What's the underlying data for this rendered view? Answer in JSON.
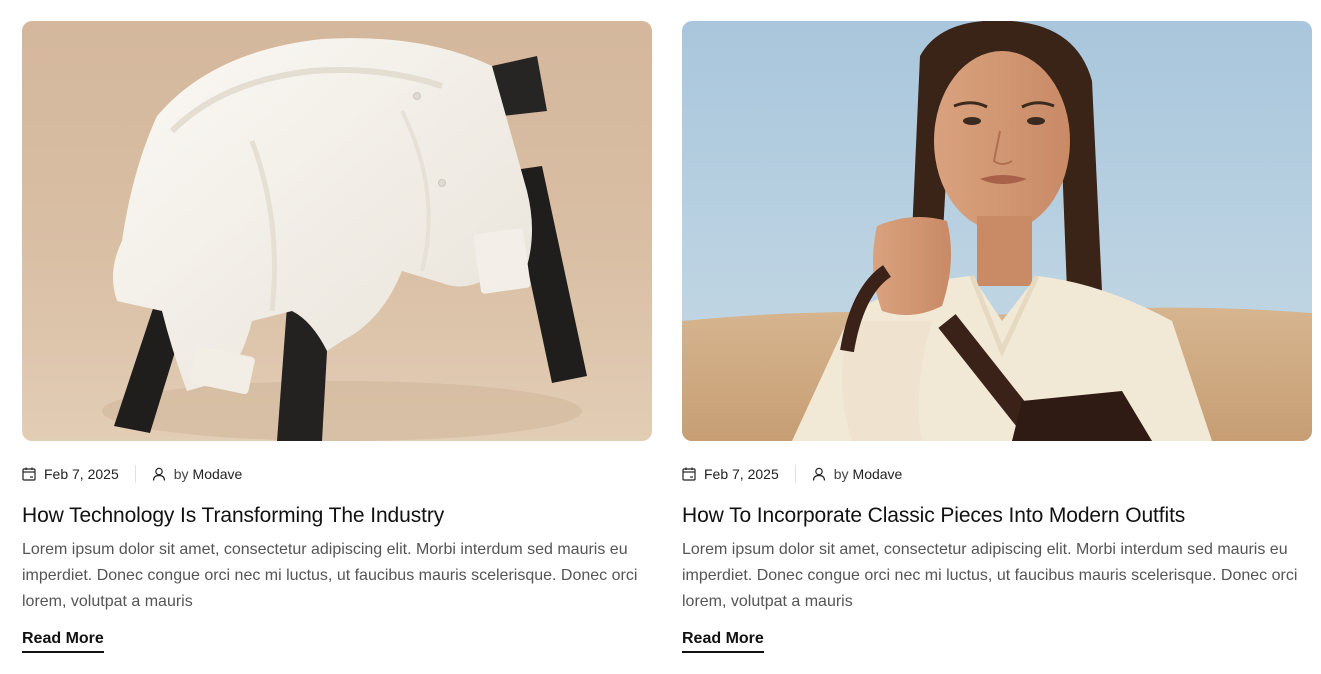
{
  "posts": [
    {
      "image_alt": "White shirt draped over a black wooden stool",
      "date": "Feb 7, 2025",
      "by": "by",
      "author": "Modave",
      "title": "How Technology Is Transforming The Industry",
      "excerpt": "Lorem ipsum dolor sit amet, consectetur adipiscing elit. Morbi interdum sed mauris eu imperdiet. Donec congue orci nec mi luctus, ut faucibus mauris scelerisque. Donec orci lorem, volutpat a mauris",
      "read_more": "Read More"
    },
    {
      "image_alt": "Woman in cream knit sweater holding a leather bag in the desert",
      "date": "Feb 7, 2025",
      "by": "by",
      "author": "Modave",
      "title": "How To Incorporate Classic Pieces Into Modern Outfits",
      "excerpt": "Lorem ipsum dolor sit amet, consectetur adipiscing elit. Morbi interdum sed mauris eu imperdiet. Donec congue orci nec mi luctus, ut faucibus mauris scelerisque. Donec orci lorem, volutpat a mauris",
      "read_more": "Read More"
    }
  ],
  "icons": {
    "date": "calendar-icon",
    "author": "user-icon"
  },
  "colors": {
    "text": "#111111",
    "muted": "#555555",
    "separator": "#e2e2e2"
  }
}
